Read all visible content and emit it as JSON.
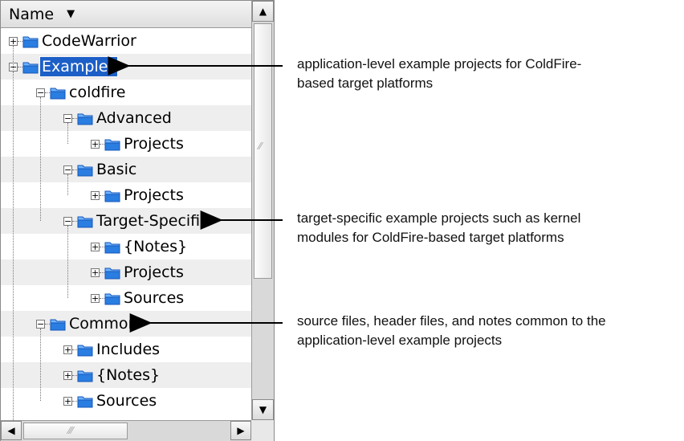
{
  "column_header": {
    "label": "Name",
    "sort_icon": "chevron-down-icon"
  },
  "tree": [
    {
      "label": "CodeWarrior",
      "level": 0,
      "expanded": false,
      "selected": false
    },
    {
      "label": "Examples",
      "level": 0,
      "expanded": true,
      "selected": true
    },
    {
      "label": "coldfire",
      "level": 1,
      "expanded": true,
      "selected": false
    },
    {
      "label": "Advanced",
      "level": 2,
      "expanded": true,
      "selected": false
    },
    {
      "label": "Projects",
      "level": 3,
      "expanded": false,
      "selected": false
    },
    {
      "label": "Basic",
      "level": 2,
      "expanded": true,
      "selected": false
    },
    {
      "label": "Projects",
      "level": 3,
      "expanded": false,
      "selected": false
    },
    {
      "label": "Target-Specific",
      "level": 2,
      "expanded": true,
      "selected": false
    },
    {
      "label": "{Notes}",
      "level": 3,
      "expanded": false,
      "selected": false
    },
    {
      "label": "Projects",
      "level": 3,
      "expanded": false,
      "selected": false
    },
    {
      "label": "Sources",
      "level": 3,
      "expanded": false,
      "selected": false
    },
    {
      "label": "Common",
      "level": 1,
      "expanded": true,
      "selected": false
    },
    {
      "label": "Includes",
      "level": 2,
      "expanded": false,
      "selected": false
    },
    {
      "label": "{Notes}",
      "level": 2,
      "expanded": false,
      "selected": false
    },
    {
      "label": "Sources",
      "level": 2,
      "expanded": false,
      "selected": false
    }
  ],
  "annotations": [
    {
      "target_row": 1,
      "lines": [
        "application-level example projects for ColdFire-",
        "based target platforms"
      ]
    },
    {
      "target_row": 7,
      "lines": [
        "target-specific example projects such as kernel",
        "modules for ColdFire-based target platforms"
      ]
    },
    {
      "target_row": 11,
      "lines": [
        "source files, header files, and notes common to the",
        "application-level example projects"
      ]
    }
  ],
  "scrollbars": {
    "up_icon": "arrow-up-icon",
    "down_icon": "arrow-down-icon",
    "left_icon": "arrow-left-icon",
    "right_icon": "arrow-right-icon"
  },
  "colors": {
    "selection": "#1c5fc7",
    "folder": "#2a7de1",
    "alt_row": "#eeeeee"
  }
}
